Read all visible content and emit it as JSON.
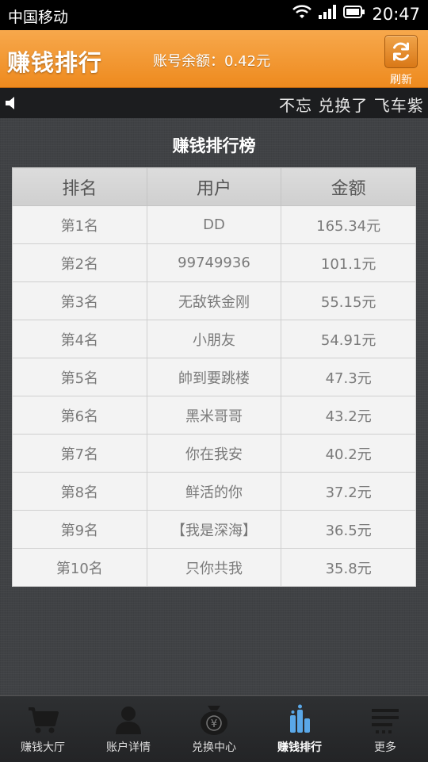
{
  "status_bar": {
    "carrier": "中国移动",
    "time": "20:47"
  },
  "header": {
    "title": "赚钱排行",
    "balance": "账号余额：0.42元",
    "refresh_label": "刷新"
  },
  "marquee": {
    "text": "不忘 兑换了 飞车紫"
  },
  "board": {
    "title": "赚钱排行榜",
    "columns": [
      "排名",
      "用户",
      "金额"
    ],
    "rows": [
      {
        "rank": "第1名",
        "user": "DD",
        "amount": "165.34元"
      },
      {
        "rank": "第2名",
        "user": "99749936",
        "amount": "101.1元"
      },
      {
        "rank": "第3名",
        "user": "无敌铁金刚",
        "amount": "55.15元"
      },
      {
        "rank": "第4名",
        "user": "小朋友",
        "amount": "54.91元"
      },
      {
        "rank": "第5名",
        "user": "帥到要跳楼",
        "amount": "47.3元"
      },
      {
        "rank": "第6名",
        "user": "黑米哥哥",
        "amount": "43.2元"
      },
      {
        "rank": "第7名",
        "user": "你在我安",
        "amount": "40.2元"
      },
      {
        "rank": "第8名",
        "user": "鲜活的你",
        "amount": "37.2元"
      },
      {
        "rank": "第9名",
        "user": "【我是深海】",
        "amount": "36.5元"
      },
      {
        "rank": "第10名",
        "user": "只你共我",
        "amount": "35.8元"
      }
    ]
  },
  "bottom_nav": {
    "items": [
      {
        "label": "赚钱大厅",
        "icon": "cart-icon"
      },
      {
        "label": "账户详情",
        "icon": "user-icon"
      },
      {
        "label": "兑换中心",
        "icon": "yen-bag-icon"
      },
      {
        "label": "赚钱排行",
        "icon": "ranking-bars-icon",
        "active": true
      },
      {
        "label": "更多",
        "icon": "menu-icon"
      }
    ]
  },
  "colors": {
    "header_orange": "#ee8a1e",
    "active_nav_blue": "#5aa8e8"
  }
}
